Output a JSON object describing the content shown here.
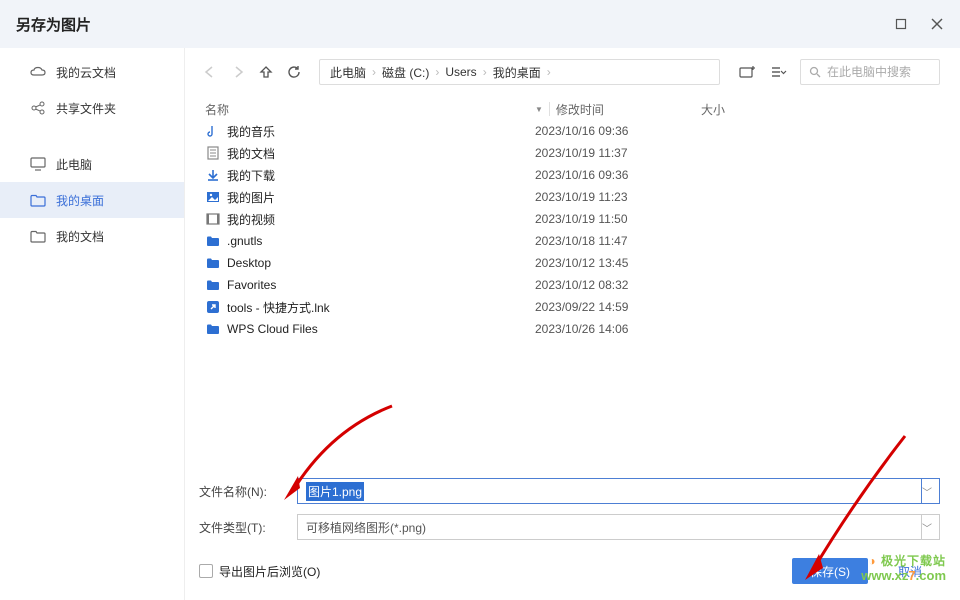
{
  "title": "另存为图片",
  "sidebar": {
    "items": [
      {
        "label": "我的云文档",
        "icon": "cloud-icon"
      },
      {
        "label": "共享文件夹",
        "icon": "share-icon"
      },
      {
        "label": "此电脑",
        "icon": "monitor-icon"
      },
      {
        "label": "我的桌面",
        "icon": "folder-icon"
      },
      {
        "label": "我的文档",
        "icon": "folder-outline-icon"
      }
    ]
  },
  "breadcrumbs": [
    "此电脑",
    "磁盘 (C:)",
    "Users",
    "我的桌面"
  ],
  "columns": {
    "name": "名称",
    "date": "修改时间",
    "size": "大小"
  },
  "search": {
    "placeholder": "在此电脑中搜索"
  },
  "files": [
    {
      "name": "我的音乐",
      "date": "2023/10/16 09:36",
      "icon": "music-file"
    },
    {
      "name": "我的文档",
      "date": "2023/10/19 11:37",
      "icon": "doc-file"
    },
    {
      "name": "我的下载",
      "date": "2023/10/16 09:36",
      "icon": "download-file"
    },
    {
      "name": "我的图片",
      "date": "2023/10/19 11:23",
      "icon": "image-file"
    },
    {
      "name": "我的视频",
      "date": "2023/10/19 11:50",
      "icon": "video-file"
    },
    {
      "name": ".gnutls",
      "date": "2023/10/18 11:47",
      "icon": "folder-blue"
    },
    {
      "name": "Desktop",
      "date": "2023/10/12 13:45",
      "icon": "folder-blue"
    },
    {
      "name": "Favorites",
      "date": "2023/10/12 08:32",
      "icon": "folder-blue"
    },
    {
      "name": "tools - 快捷方式.lnk",
      "date": "2023/09/22 14:59",
      "icon": "shortcut-file"
    },
    {
      "name": "WPS Cloud Files",
      "date": "2023/10/26 14:06",
      "icon": "folder-blue"
    }
  ],
  "form": {
    "filename_label": "文件名称(N):",
    "filename_value": "图片1.png",
    "filetype_label": "文件类型(T):",
    "filetype_value": "可移植网络图形(*.png)",
    "checkbox_label": "导出图片后浏览(O)",
    "save_button": "保存(S)",
    "cancel_button": "取消"
  },
  "watermark": {
    "line1": "极光下载站",
    "line2_pre": "www.xz",
    "line2_seven": "7",
    "line2_post": ".com"
  }
}
